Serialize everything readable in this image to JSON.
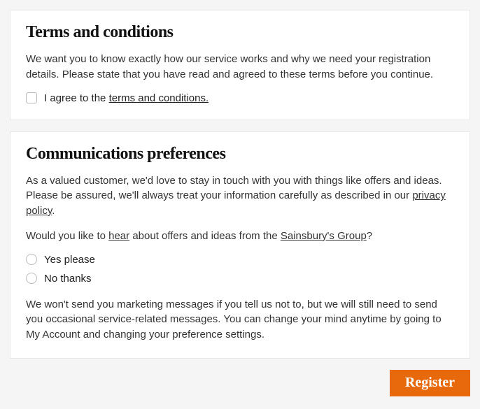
{
  "terms": {
    "heading": "Terms and conditions",
    "description": "We want you to know exactly how our service works and why we need your registration details. Please state that you have read and agreed to these terms before you continue.",
    "checkbox_prefix": "I agree to the ",
    "checkbox_link": "terms and conditions."
  },
  "comms": {
    "heading": "Communications preferences",
    "intro_prefix": "As a valued customer, we'd love to stay in touch with you with things like offers and ideas. Please be assured, we'll always treat your information carefully as described in our ",
    "intro_link": "privacy policy",
    "intro_suffix": ".",
    "question_prefix": "Would you like to ",
    "question_link1": "hear",
    "question_mid": " about offers and ideas from the ",
    "question_link2": "Sainsbury's Group",
    "question_suffix": "?",
    "option_yes": "Yes please",
    "option_no": "No thanks",
    "disclaimer": "We won't send you marketing messages if you tell us not to, but we will still need to send you occasional service-related messages. You can change your mind anytime by going to My Account and changing your preference settings."
  },
  "footer": {
    "register_label": "Register"
  }
}
